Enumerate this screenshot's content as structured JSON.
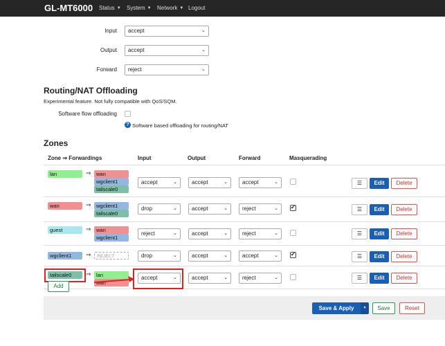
{
  "navbar": {
    "brand": "GL-MT6000",
    "items": [
      {
        "label": "Status"
      },
      {
        "label": "System"
      },
      {
        "label": "Network"
      },
      {
        "label": "Logout"
      }
    ]
  },
  "defaults": {
    "input_label": "Input",
    "input_value": "accept",
    "output_label": "Output",
    "output_value": "accept",
    "forward_label": "Forward",
    "forward_value": "reject"
  },
  "offload": {
    "title": "Routing/NAT Offloading",
    "desc": "Experimental feature. Not fully compatible with QoS/SQM.",
    "sw_label": "Software flow offloading",
    "sw_checked": false,
    "help": "Software based offloading for routing/NAT"
  },
  "zones": {
    "title": "Zones",
    "headers": {
      "zone": "Zone ⇒ Forwardings",
      "input": "Input",
      "output": "Output",
      "forward": "Forward",
      "masq": "Masquerading"
    },
    "arrow": "⇒",
    "rows": [
      {
        "zone": "lan",
        "fwd": [
          "wan",
          "wgclient1",
          "tailscale0"
        ],
        "input": "accept",
        "output": "accept",
        "forward": "accept",
        "masq": false
      },
      {
        "zone": "wan",
        "fwd": [
          "wgclient1",
          "tailscale0"
        ],
        "input": "drop",
        "output": "accept",
        "forward": "reject",
        "masq": true
      },
      {
        "zone": "guest",
        "fwd": [
          "wan",
          "wgclient1"
        ],
        "input": "reject",
        "output": "accept",
        "forward": "reject",
        "masq": false
      },
      {
        "zone": "wgclient1",
        "fwd": [
          "REJECT"
        ],
        "input": "drop",
        "output": "accept",
        "forward": "accept",
        "masq": true
      },
      {
        "zone": "tailscale0",
        "fwd": [
          "lan",
          "wan"
        ],
        "input": "accept",
        "output": "accept",
        "forward": "reject",
        "masq": false
      }
    ],
    "menu_label": "☰",
    "edit_label": "Edit",
    "delete_label": "Delete",
    "add_label": "Add"
  },
  "footer": {
    "save_apply": "Save & Apply",
    "save_apply_caret": "▾",
    "save": "Save",
    "reset": "Reset"
  },
  "colors": {
    "navbar": "#262626",
    "primary": "#1a5fb4",
    "danger": "#e05050",
    "positive": "#2a9a50",
    "highlight": "#e02020",
    "zone_lan": "#90f090",
    "zone_wan": "#f09090",
    "zone_guest": "#a8e8ee",
    "zone_wgclient1": "#94b7e0",
    "zone_tailscale0": "#7fbfa8"
  }
}
